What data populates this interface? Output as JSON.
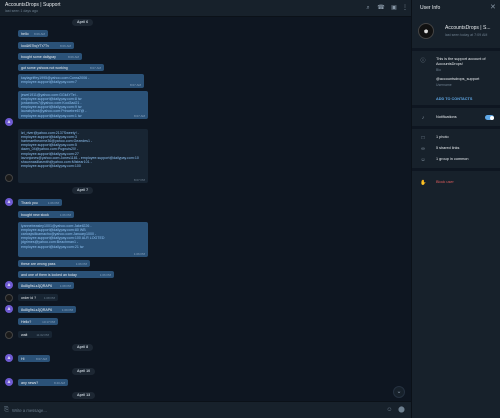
{
  "header": {
    "title": "AccountsDrops | Support",
    "status": "last seen 1 days ago"
  },
  "dates": [
    "April 6",
    "April 7",
    "April 8",
    "April 10",
    "April 13"
  ],
  "messages": [
    {
      "lines": [
        "hello"
      ],
      "time": "8:06 AM"
    },
    {
      "lines": [
        "Ioo&f67bqYTr7Tv"
      ],
      "time": "8:06 AM"
    },
    {
      "lines": [
        "bought some dailypay"
      ],
      "time": "8:06 AM"
    },
    {
      "lines": [
        "got some yahoos not working"
      ],
      "time": "8:07 AM"
    },
    {
      "lines": [
        "kaylagriffey1995@yahoo.com:Conra2006 -",
        "employee.support@dailypay.com:7"
      ],
      "time": "8:07 AM"
    },
    {
      "lines": [
        "jewel1911@yahoo.com:GGk4YTei -",
        "employee.support@dailypay.com:8 tw",
        "jordanbors7@yahoo.com:Kool3ad21 -",
        "employee.support@dailypay.com:9 tw",
        "laurabyford@yahoo.com:Princebre67@ -",
        "employee.support@dailypay.com:1 tw"
      ],
      "time": "8:07 AM"
    },
    {
      "lines": [
        "lzt_river@yahoo.com:2137Sweety! -",
        "employee.support@dailypay.com:3",
        "hartmaefheorme36@yahoo.com:Gezedes1 -",
        "employee.support@dailypay.com:5",
        "dawn_04@yahoo.com:Pugnuts20! -",
        "employee.support@dailypay.com:27",
        "lavonjones@yahoo.com:Jones1181 - employee.support@dailypay.com:10",
        "shaunnasillasmith@yahoo.com:Mistear101 -",
        "employee.support@dailypay.com:100"
      ],
      "time": "8:07 PM"
    },
    {
      "lines": [
        "Thank you"
      ],
      "time": "1:06 PM"
    },
    {
      "lines": [
        "bought new stock"
      ],
      "time": "1:06 PM"
    },
    {
      "lines": [
        "lyannebeasley1001@yahoo.com:Jakell226 -",
        "employee.support@dailypay.com:80 WB",
        "carlosjwillcamacho@yahoo.com:January1000 -",
        "employee.support@dailypay.com:100 ALR LOGTED",
        "jdgrimes@yahoo.com:Beachman1 -",
        "employee.support@dailypay.com:21 tw"
      ],
      "time": "1:06 PM"
    },
    {
      "lines": [
        "these are wrong pass"
      ],
      "time": "1:06 PM"
    },
    {
      "lines": [
        "and one of them is locked an today"
      ],
      "time": "1:06 PM"
    },
    {
      "lines": [
        "8u8ig9sLzJjQRAP6"
      ],
      "time": "1:08 PM"
    },
    {
      "lines": [
        "order id ?"
      ],
      "time": "1:08 PM"
    },
    {
      "lines": [
        "8u8ig9sLzJjQRAP6"
      ],
      "time": "1:09 PM"
    },
    {
      "lines": [
        "Hello?"
      ],
      "time": "10:17 PM"
    },
    {
      "lines": [
        "wait"
      ],
      "time": "11:02 PM"
    },
    {
      "lines": [
        "Hi"
      ],
      "time": "8:07 AM"
    },
    {
      "lines": [
        "any news?"
      ],
      "time": "8:40 AM"
    }
  ],
  "avatar_letter": "A",
  "composer": {
    "placeholder": "Write a message..."
  },
  "info": {
    "title": "User Info",
    "name": "AccountsDrops | S...",
    "seen": "last seen today at 7:09 AM",
    "bio_lines": [
      "This is the support account of",
      "AccountsDrops!"
    ],
    "bio_label": "Bio",
    "username": "@accountsdrops_support",
    "username_label": "Username",
    "add_contacts": "ADD TO CONTACTS",
    "notifications": "Notifications",
    "notifications_on": true,
    "photos": "1 photo",
    "links": "5 shared links",
    "groups": "1 group in common",
    "block": "Block user"
  },
  "colors": {
    "background": "#0e1621",
    "panel": "#17212b",
    "outgoing_bubble": "#2b5278",
    "accent": "#5fa9e8",
    "danger": "#e05d5d",
    "avatar": "#6f5bd3"
  }
}
